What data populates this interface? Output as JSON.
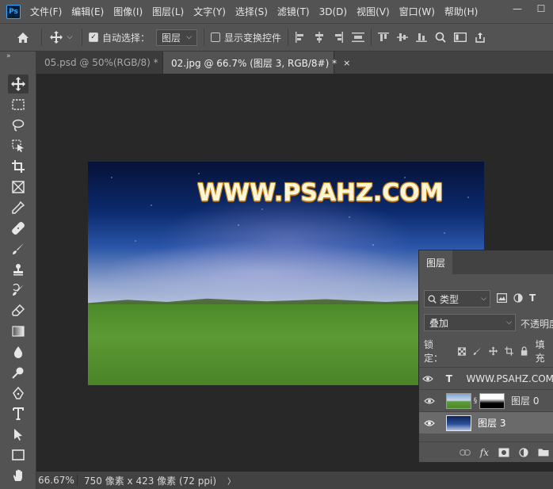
{
  "app": {
    "logo": "Ps"
  },
  "menu": [
    "文件(F)",
    "编辑(E)",
    "图像(I)",
    "图层(L)",
    "文字(Y)",
    "选择(S)",
    "滤镜(T)",
    "3D(D)",
    "视图(V)",
    "窗口(W)",
    "帮助(H)"
  ],
  "window_controls": {
    "minimize": "—",
    "maximize": "☐"
  },
  "options": {
    "home_icon": "home-icon",
    "auto_select_label": "自动选择：",
    "auto_select_value": "图层",
    "show_transform_label": "显示变换控件"
  },
  "tabs": [
    {
      "label": "05.psd @ 50%(RGB/8) *",
      "close": "×"
    },
    {
      "label": "02.jpg @ 66.7% (图层 3, RGB/8#) *",
      "close": "×"
    }
  ],
  "canvas": {
    "watermark_text": "WWW.PSAHZ.COM"
  },
  "layers_panel": {
    "tab_label": "图层",
    "filter_label": "类型",
    "blend_mode": "叠加",
    "opacity_label": "不透明度",
    "lock_label": "锁定：",
    "fill_label": "填充",
    "layers": [
      {
        "type_glyph": "T",
        "name": "WWW.PSAHZ.COM"
      },
      {
        "name": "图层 0"
      },
      {
        "name": "图层 3"
      }
    ]
  },
  "status": {
    "zoom": "66.67%",
    "info": "750 像素 x 423 像素 (72 ppi)",
    "arrow": "〉"
  },
  "colors": {
    "panel": "#535353",
    "workspace": "#282828",
    "accent": "#31a8ff",
    "watermark_outline": "#c8861a"
  }
}
